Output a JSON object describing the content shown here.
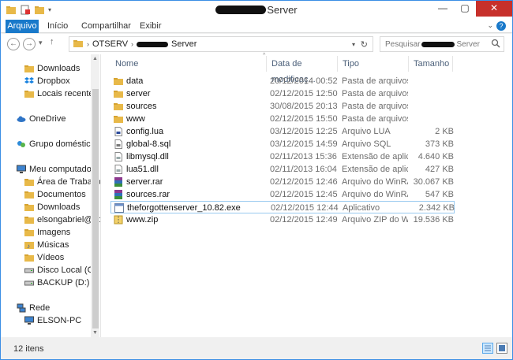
{
  "window": {
    "title_suffix": "Server",
    "controls": {
      "minimize": "—",
      "maximize": "▢",
      "close": "✕"
    }
  },
  "ribbon": {
    "tabs": [
      {
        "label": "Arquivo"
      },
      {
        "label": "Início"
      },
      {
        "label": "Compartilhar"
      },
      {
        "label": "Exibir"
      }
    ],
    "help": "?"
  },
  "address": {
    "crumbs": [
      "OTSERV",
      "Server"
    ],
    "search_placeholder_prefix": "Pesquisar",
    "search_placeholder_suffix": "Server"
  },
  "navpane": {
    "items": [
      {
        "label": "Downloads",
        "icon": "downloads-icon"
      },
      {
        "label": "Dropbox",
        "icon": "dropbox-icon"
      },
      {
        "label": "Locais recentes",
        "icon": "recent-places-icon"
      },
      {
        "label": "OneDrive",
        "icon": "onedrive-icon"
      },
      {
        "label": "Grupo doméstico",
        "icon": "homegroup-icon"
      },
      {
        "label": "Meu computador",
        "icon": "computer-icon"
      },
      {
        "label": "Área de Trabalho",
        "icon": "desktop-icon"
      },
      {
        "label": "Documentos",
        "icon": "documents-icon"
      },
      {
        "label": "Downloads",
        "icon": "downloads-icon"
      },
      {
        "label": "elsongabriel@ho",
        "icon": "user-folder-icon"
      },
      {
        "label": "Imagens",
        "icon": "pictures-icon"
      },
      {
        "label": "Músicas",
        "icon": "music-icon"
      },
      {
        "label": "Vídeos",
        "icon": "videos-icon"
      },
      {
        "label": "Disco Local (C:)",
        "icon": "local-disk-icon"
      },
      {
        "label": "BACKUP (D:)",
        "icon": "drive-icon"
      },
      {
        "label": "Rede",
        "icon": "network-icon"
      },
      {
        "label": "ELSON-PC",
        "icon": "pc-icon"
      }
    ]
  },
  "columns": {
    "name": "Nome",
    "date": "Data de modificaç...",
    "type": "Tipo",
    "size": "Tamanho"
  },
  "files": [
    {
      "name": "data",
      "date": "20/12/2014 00:52",
      "type": "Pasta de arquivos",
      "size": "",
      "icon": "folder-icon"
    },
    {
      "name": "server",
      "date": "02/12/2015 12:50",
      "type": "Pasta de arquivos",
      "size": "",
      "icon": "folder-icon"
    },
    {
      "name": "sources",
      "date": "30/08/2015 20:13",
      "type": "Pasta de arquivos",
      "size": "",
      "icon": "folder-icon"
    },
    {
      "name": "www",
      "date": "02/12/2015 15:50",
      "type": "Pasta de arquivos",
      "size": "",
      "icon": "folder-icon"
    },
    {
      "name": "config.lua",
      "date": "03/12/2015 12:25",
      "type": "Arquivo LUA",
      "size": "2 KB",
      "icon": "lua-file-icon"
    },
    {
      "name": "global-8.sql",
      "date": "03/12/2015 14:59",
      "type": "Arquivo SQL",
      "size": "373 KB",
      "icon": "sql-file-icon"
    },
    {
      "name": "libmysql.dll",
      "date": "02/11/2013 15:36",
      "type": "Extensão de aplica...",
      "size": "4.640 KB",
      "icon": "dll-file-icon"
    },
    {
      "name": "lua51.dll",
      "date": "02/11/2013 16:04",
      "type": "Extensão de aplica...",
      "size": "427 KB",
      "icon": "dll-file-icon"
    },
    {
      "name": "server.rar",
      "date": "02/12/2015 12:46",
      "type": "Arquivo do WinRAR",
      "size": "30.067 KB",
      "icon": "rar-file-icon"
    },
    {
      "name": "sources.rar",
      "date": "02/12/2015 12:45",
      "type": "Arquivo do WinRAR",
      "size": "547 KB",
      "icon": "rar-file-icon"
    },
    {
      "name": "theforgottenserver_10.82.exe",
      "date": "02/12/2015 12:44",
      "type": "Aplicativo",
      "size": "2.342 KB",
      "icon": "exe-file-icon",
      "selected": true
    },
    {
      "name": "www.zip",
      "date": "02/12/2015 12:49",
      "type": "Arquivo ZIP do Wi...",
      "size": "19.536 KB",
      "icon": "zip-file-icon"
    }
  ],
  "status": {
    "count": "12 itens"
  }
}
